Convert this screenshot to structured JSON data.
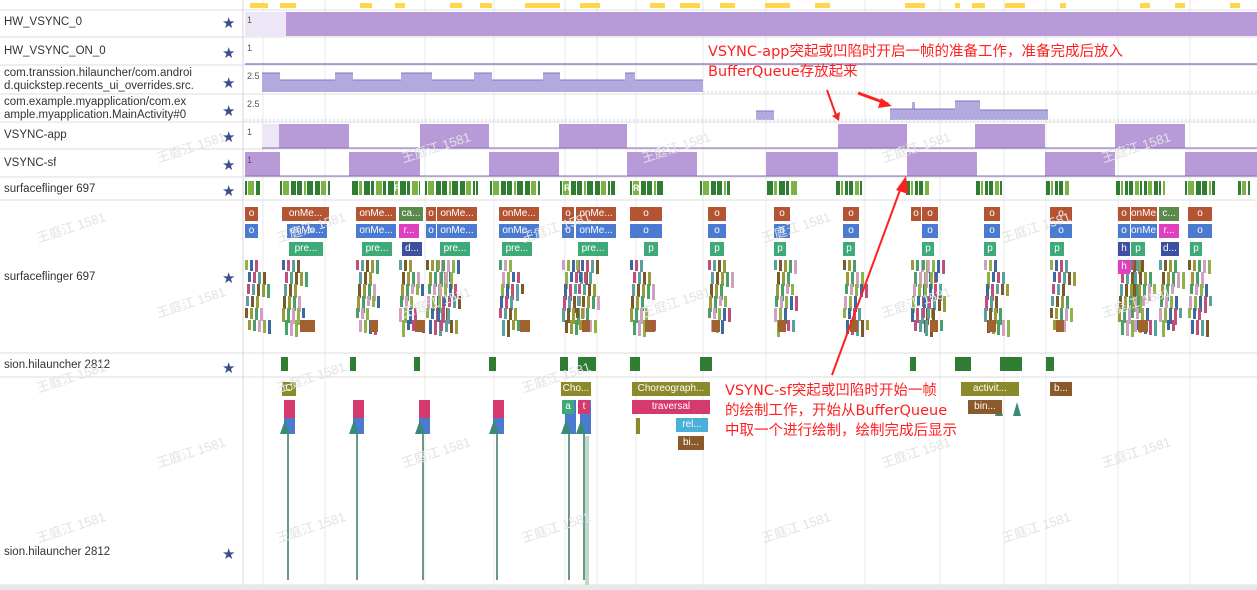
{
  "tracks": [
    {
      "id": "hw-vsync-0",
      "label": "HW_VSYNC_0",
      "value": "1"
    },
    {
      "id": "hw-vsync-on-0",
      "label": "HW_VSYNC_ON_0",
      "value": "1"
    },
    {
      "id": "launcher-recents",
      "label_line1": "com.transsion.hilauncher/com.androi",
      "label_line2": "d.quickstep.recents_ui_overrides.src.",
      "value": "2.5"
    },
    {
      "id": "myapplication",
      "label_line1": "com.example.myapplication/com.ex",
      "label_line2": "ample.myapplication.MainActivity#0",
      "value": "2.5"
    },
    {
      "id": "vsync-app",
      "label": "VSYNC-app",
      "value": "1"
    },
    {
      "id": "vsync-sf",
      "label": "VSYNC-sf",
      "value": "1"
    },
    {
      "id": "sf-thread",
      "label": "surfaceflinger 697",
      "marker": "R"
    },
    {
      "id": "sf-slices",
      "label": "surfaceflinger 697"
    },
    {
      "id": "launcher-thread",
      "label": "sion.hilauncher 2812"
    },
    {
      "id": "launcher-slices",
      "label": "sion.hilauncher 2812"
    }
  ],
  "star_icon": "★",
  "annotations": {
    "app": {
      "line1": "VSYNC-app突起或凹陷时开启一帧的准备工作，准备完成后放入",
      "line2": "BufferQueue存放起来"
    },
    "sf": {
      "line1": "VSYNC-sf突起或凹陷时开始一帧",
      "line2": "的绘制工作，开始从BufferQueue",
      "line3": "中取一个进行绘制，绘制完成后显示"
    }
  },
  "watermark": "王庭江 1581",
  "slice_labels": {
    "o": "o",
    "onMe": "onMe...",
    "onMe2": "onMe...",
    "pre": "pre...",
    "ca": "ca...",
    "r": "r...",
    "d": "d...",
    "p": "p",
    "h": "h",
    "c": "c...",
    "C": "C",
    "Cho": "Cho...",
    "a": "a",
    "t": "t",
    "choreograph": "Choreograph...",
    "traversal": "traversal",
    "rel": "rel...",
    "bi": "bi...",
    "activit": "activit...",
    "bin": "bin...",
    "b": "b..."
  },
  "colors": {
    "counter": "#b89ad8",
    "counter_line": "#8a6cc0",
    "counter2": "#b0aadf",
    "counter2_line": "#7f77c2",
    "sf_green": "#2e7d32",
    "annotation": "#ff2020",
    "star": "#3a4d8f"
  }
}
